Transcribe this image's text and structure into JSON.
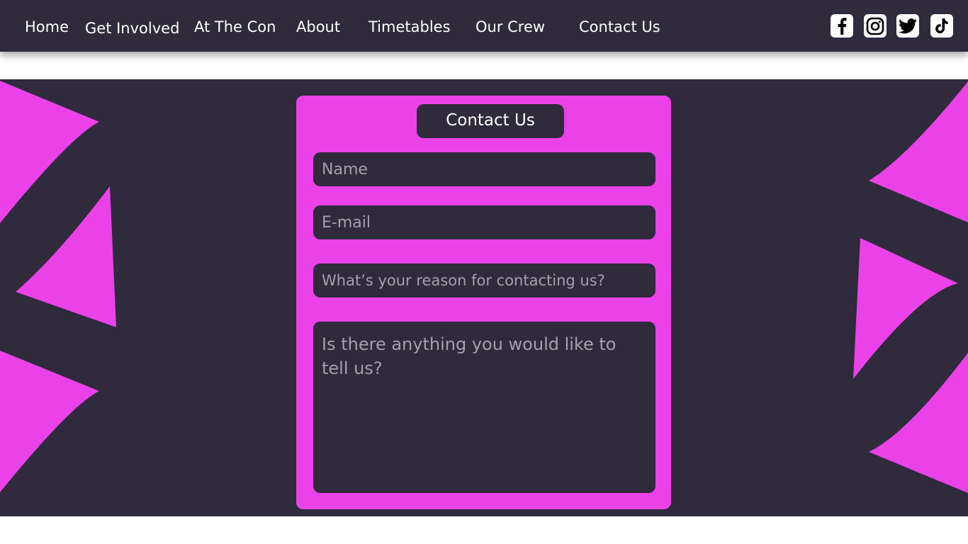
{
  "nav": {
    "links": [
      {
        "label": "Home"
      },
      {
        "label": "Get Involved"
      },
      {
        "label": "At The Con"
      },
      {
        "label": "About"
      },
      {
        "label": "Timetables"
      },
      {
        "label": "Our Crew"
      },
      {
        "label": "Contact Us"
      }
    ],
    "social": [
      "facebook-icon",
      "instagram-icon",
      "twitter-icon",
      "tiktok-icon"
    ]
  },
  "contact_form": {
    "title": "Contact Us",
    "name_placeholder": "Name",
    "email_placeholder": "E-mail",
    "reason_placeholder": "What’s your reason for contacting us?",
    "message_placeholder": "Is there anything you would like to tell us?"
  },
  "colors": {
    "dark": "#2f2a3c",
    "accent": "#ea42e8",
    "text": "#ffffff",
    "placeholder": "#a59fb0"
  }
}
